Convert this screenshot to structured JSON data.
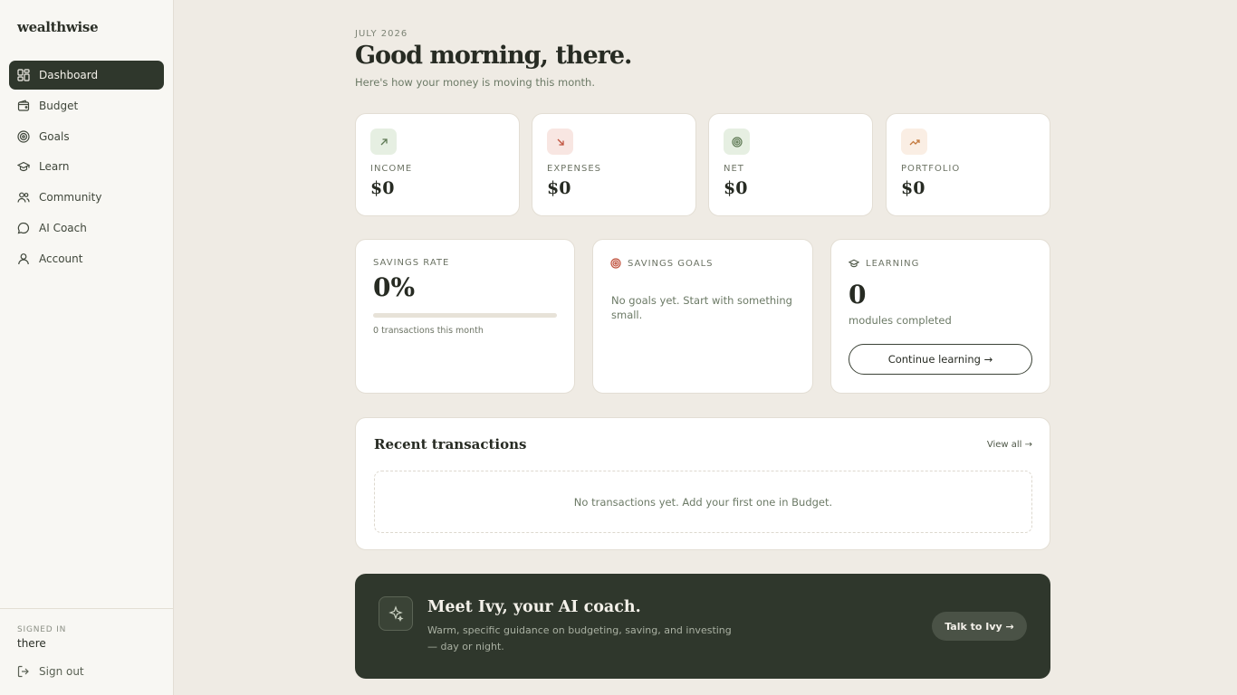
{
  "brand": "wealthwise",
  "nav": [
    {
      "label": "Dashboard",
      "icon": "grid-icon",
      "active": true
    },
    {
      "label": "Budget",
      "icon": "wallet-icon"
    },
    {
      "label": "Goals",
      "icon": "target-icon"
    },
    {
      "label": "Learn",
      "icon": "graduation-cap-icon"
    },
    {
      "label": "Community",
      "icon": "users-icon"
    },
    {
      "label": "AI Coach",
      "icon": "chat-bubble-icon"
    },
    {
      "label": "Account",
      "icon": "user-icon"
    }
  ],
  "footer": {
    "signed_in_label": "SIGNED IN",
    "user_name": "there",
    "sign_out": "Sign out"
  },
  "header": {
    "month": "JULY 2026",
    "greeting": "Good morning, there.",
    "subtitle": "Here's how your money is moving this month."
  },
  "stats": [
    {
      "label": "INCOME",
      "value": "$0",
      "icon": "arrow-up-right-icon",
      "badge_bg": "#e6efe2",
      "icon_color": "#5f7a55"
    },
    {
      "label": "EXPENSES",
      "value": "$0",
      "icon": "arrow-down-right-icon",
      "badge_bg": "#f8e6e2",
      "icon_color": "#c0533f"
    },
    {
      "label": "NET",
      "value": "$0",
      "icon": "target-icon",
      "badge_bg": "#e6efe2",
      "icon_color": "#5f7a55"
    },
    {
      "label": "PORTFOLIO",
      "value": "$0",
      "icon": "trending-up-icon",
      "badge_bg": "#faeee4",
      "icon_color": "#c47a3f"
    }
  ],
  "savings_rate": {
    "label": "SAVINGS RATE",
    "value": "0%",
    "progress": 0,
    "transactions_text": "0 transactions this month"
  },
  "savings_goals": {
    "label": "SAVINGS GOALS",
    "empty_text": "No goals yet. Start with something small."
  },
  "learning": {
    "label": "LEARNING",
    "value": "0",
    "sub": "modules completed",
    "button": "Continue learning →"
  },
  "recent": {
    "title": "Recent transactions",
    "view_all": "View all →",
    "empty_text": "No transactions yet. Add your first one in Budget."
  },
  "ivy": {
    "title": "Meet Ivy, your AI coach.",
    "subtitle": "Warm, specific guidance on budgeting, saving, and investing — day or night.",
    "button": "Talk to Ivy →"
  },
  "colors": {
    "accent_dark": "#2f372c",
    "background": "#efebe4",
    "sidebar": "#f8f7f3",
    "expense_red": "#c0533f",
    "income_green": "#5f7a55"
  }
}
